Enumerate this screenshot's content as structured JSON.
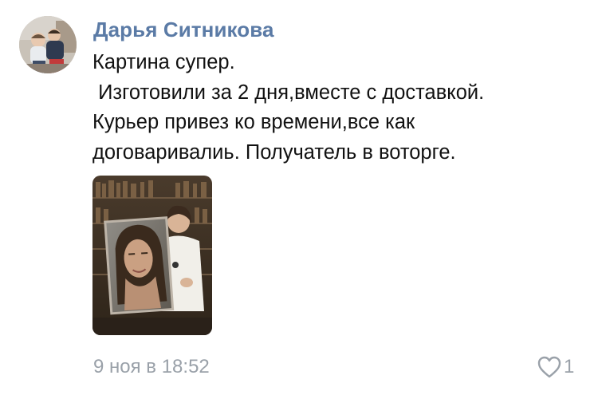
{
  "comment": {
    "author": "Дарья Ситникова",
    "text": "Картина супер.\n Изготовили за 2 дня,вместе с доставкой.\nКурьер привез ко времени,все как\nдоговаривалиь. Получатель в воторге.",
    "date": "9 ноя в 18:52",
    "likes": "1",
    "icons": {
      "like": "heart-outline-icon"
    },
    "colors": {
      "author": "#5b7ba6",
      "meta": "#9aa1a9",
      "text": "#111111"
    }
  }
}
